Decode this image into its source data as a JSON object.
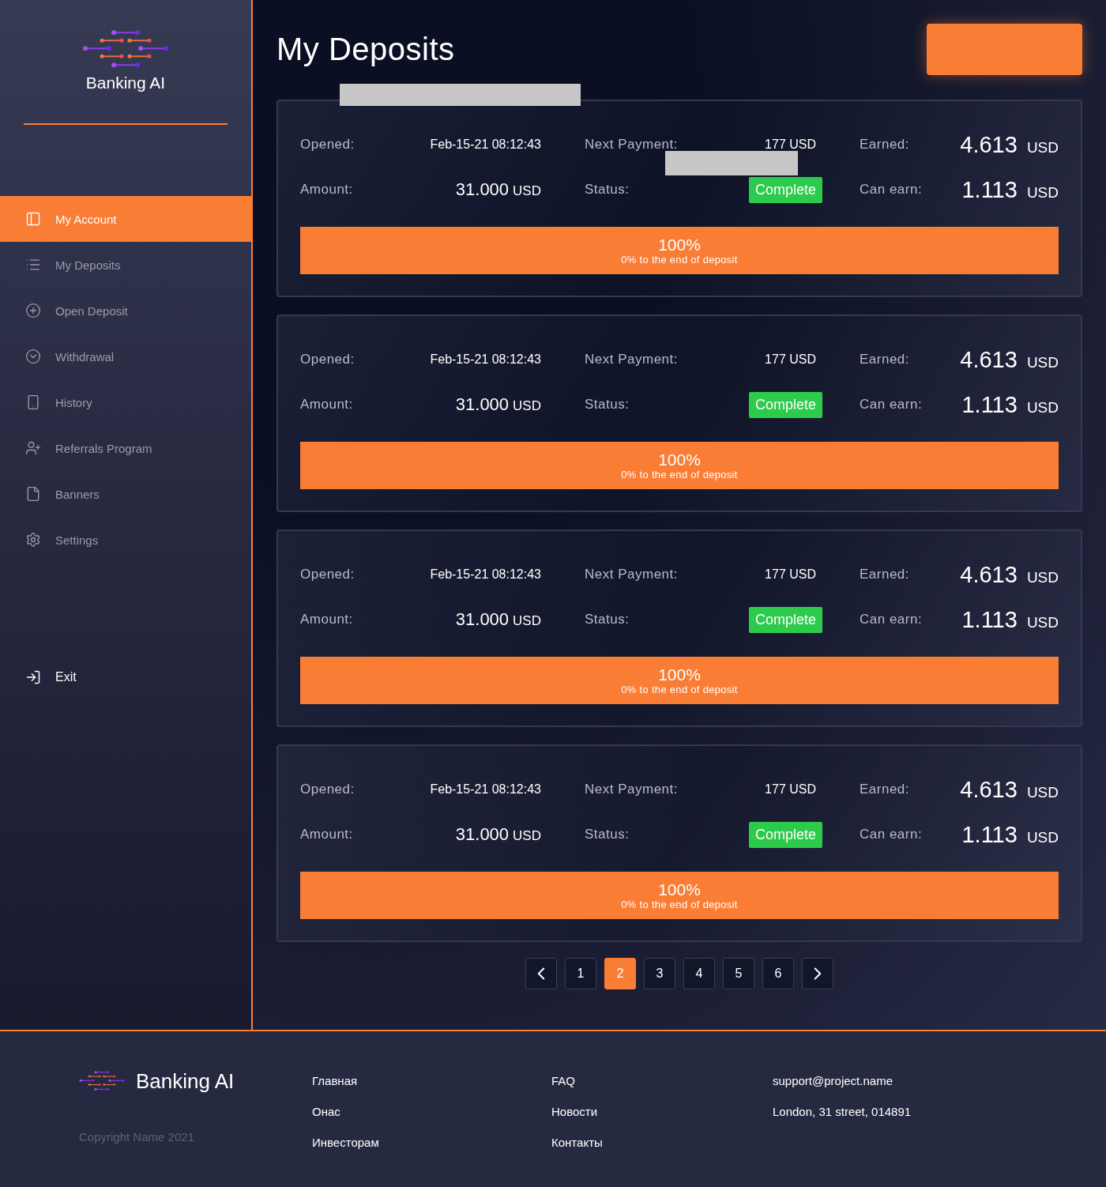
{
  "sidebar": {
    "brand": "Banking AI",
    "items": [
      {
        "label": "My Account",
        "kind": "panel",
        "selected": true
      },
      {
        "label": "My Deposits",
        "kind": "list",
        "selected": false
      },
      {
        "label": "Open Deposit",
        "kind": "plus",
        "selected": false
      },
      {
        "label": "Withdrawal",
        "kind": "down",
        "selected": false
      },
      {
        "label": "History",
        "kind": "phone",
        "selected": false
      },
      {
        "label": "Referrals Program",
        "kind": "user",
        "selected": false
      },
      {
        "label": "Banners",
        "kind": "file",
        "selected": false
      },
      {
        "label": "Settings",
        "kind": "gear",
        "selected": false
      }
    ],
    "exit": "Exit"
  },
  "header": {
    "title": "My Deposits"
  },
  "deposits": [
    {
      "opened_label": "Opened:",
      "opened": "Feb-15-21 08:12:43",
      "amount_label": "Amount:",
      "amount": "31.000",
      "amount_unit": "USD",
      "next_label": "Next Payment:",
      "next": "177 USD",
      "status_label": "Status:",
      "status": "Complete",
      "earned_label": "Earned:",
      "earned": "4.613",
      "earned_unit": "USD",
      "can_label": "Can earn:",
      "can": "1.113",
      "can_unit": "USD",
      "progress": {
        "level": 1,
        "percent": "100%",
        "caption": "0% to the end of deposit"
      }
    },
    {
      "opened_label": "Opened:",
      "opened": "Feb-15-21 08:12:43",
      "amount_label": "Amount:",
      "amount": "31.000",
      "amount_unit": "USD",
      "next_label": "Next Payment:",
      "next": "177 USD",
      "status_label": "Status:",
      "status": "Complete",
      "earned_label": "Earned:",
      "earned": "4.613",
      "earned_unit": "USD",
      "can_label": "Can earn:",
      "can": "1.113",
      "can_unit": "USD",
      "progress": {
        "level": 1,
        "percent": "100%",
        "caption": "0% to the end of deposit"
      }
    },
    {
      "opened_label": "Opened:",
      "opened": "Feb-15-21 08:12:43",
      "amount_label": "Amount:",
      "amount": "31.000",
      "amount_unit": "USD",
      "next_label": "Next Payment:",
      "next": "177 USD",
      "status_label": "Status:",
      "status": "Complete",
      "earned_label": "Earned:",
      "earned": "4.613",
      "earned_unit": "USD",
      "can_label": "Can earn:",
      "can": "1.113",
      "can_unit": "USD",
      "progress": {
        "level": 1,
        "percent": "100%",
        "caption": "0% to the end of deposit"
      }
    },
    {
      "opened_label": "Opened:",
      "opened": "Feb-15-21 08:12:43",
      "amount_label": "Amount:",
      "amount": "31.000",
      "amount_unit": "USD",
      "next_label": "Next Payment:",
      "next": "177 USD",
      "status_label": "Status:",
      "status": "Complete",
      "earned_label": "Earned:",
      "earned": "4.613",
      "earned_unit": "USD",
      "can_label": "Can earn:",
      "can": "1.113",
      "can_unit": "USD",
      "progress": {
        "level": 1,
        "percent": "100%",
        "caption": "0% to the end of deposit"
      }
    }
  ],
  "pagination": [
    {
      "label": "1",
      "selected": false
    },
    {
      "label": "2",
      "selected": true
    },
    {
      "label": "3",
      "selected": false
    },
    {
      "label": "4",
      "selected": false
    },
    {
      "label": "5",
      "selected": false
    },
    {
      "label": "6",
      "selected": false
    }
  ],
  "footer": {
    "brand": "Banking AI",
    "copyright": "Copyright Name 2021",
    "link_columns": [
      [
        "Главная",
        "Онас",
        "Инвесторам"
      ],
      [
        "FAQ",
        "Новости",
        "Контакты"
      ]
    ],
    "contacts": [
      "support@project.name",
      "London, 31 street, 014891"
    ]
  }
}
